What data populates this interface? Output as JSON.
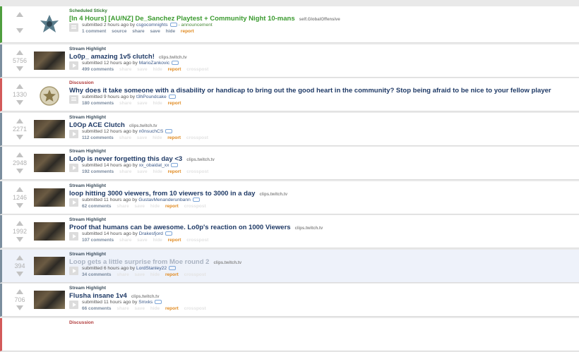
{
  "posts": [
    {
      "flair": "Scheduled Sticky",
      "title": "[In 4 Hours] [AU/NZ] De_Sanchez Playtest + Community Night 10-mans",
      "domain": "self.GlobalOffensive",
      "score": "",
      "time": "2 hours ago",
      "author": "csgocomnights",
      "extra": "- announcement",
      "comments": "1 comment",
      "actions": [
        "source",
        "share",
        "save",
        "hide"
      ],
      "report": "report"
    },
    {
      "flair": "Stream Highlight",
      "title": "Lo0p_ amazing 1v5 clutch!",
      "domain": "clips.twitch.tv",
      "score": "5756",
      "time": "12 hours ago",
      "author": "MarioZankovic",
      "comments": "499 comments",
      "report": "report"
    },
    {
      "flair": "Discussion",
      "title": "Why does it take someone with a disability or handicap to bring out the good heart in the community? Stop being afraid to be nice to your fellow player",
      "domain": "",
      "score": "1330",
      "time": "9 hours ago",
      "author": "t3hPoundcake",
      "comments": "180 comments",
      "report": "report"
    },
    {
      "flair": "Stream Highlight",
      "title": "L0Op ACE Clutch",
      "domain": "clips.twitch.tv",
      "score": "2271",
      "time": "12 hours ago",
      "author": "n0nsuchCS",
      "comments": "112 comments",
      "report": "report"
    },
    {
      "flair": "Stream Highlight",
      "title": "Lo0p is never forgetting this day <3",
      "domain": "clips.twitch.tv",
      "score": "2948",
      "time": "14 hours ago",
      "author": "xx_obaidat_xx",
      "comments": "192 comments",
      "report": "report"
    },
    {
      "flair": "Stream Highlight",
      "title": "loop hitting 3000 viewers, from 10 viewers to 3000 in a day",
      "domain": "clips.twitch.tv",
      "score": "1246",
      "time": "11 hours ago",
      "author": "GustavMenanderunbann",
      "comments": "62 comments",
      "report": "report"
    },
    {
      "flair": "Stream Highlight",
      "title": "Proof that humans can be awesome. Lo0p's reaction on 1000 Viewers",
      "domain": "clips.twitch.tv",
      "score": "1992",
      "time": "14 hours ago",
      "author": "Drakesfjord",
      "comments": "107 comments",
      "report": "report"
    },
    {
      "flair": "Stream Highlight",
      "title": "Loop gets a little surprise from Moe round 2",
      "domain": "clips.twitch.tv",
      "score": "394",
      "time": "6 hours ago",
      "author": "LordStanley22",
      "comments": "34 comments",
      "report": "report"
    },
    {
      "flair": "Stream Highlight",
      "title": "Flusha insane 1v4",
      "domain": "clips.twitch.tv",
      "score": "706",
      "time": "11 hours ago",
      "author": "Smxks",
      "comments": "66 comments",
      "report": "report"
    },
    {
      "flair": "Discussion"
    }
  ],
  "faint_actions": [
    "share",
    "save",
    "hide"
  ],
  "faint_crosspost": "crosspost",
  "submitted_prefix": "submitted",
  "by_word": "by"
}
